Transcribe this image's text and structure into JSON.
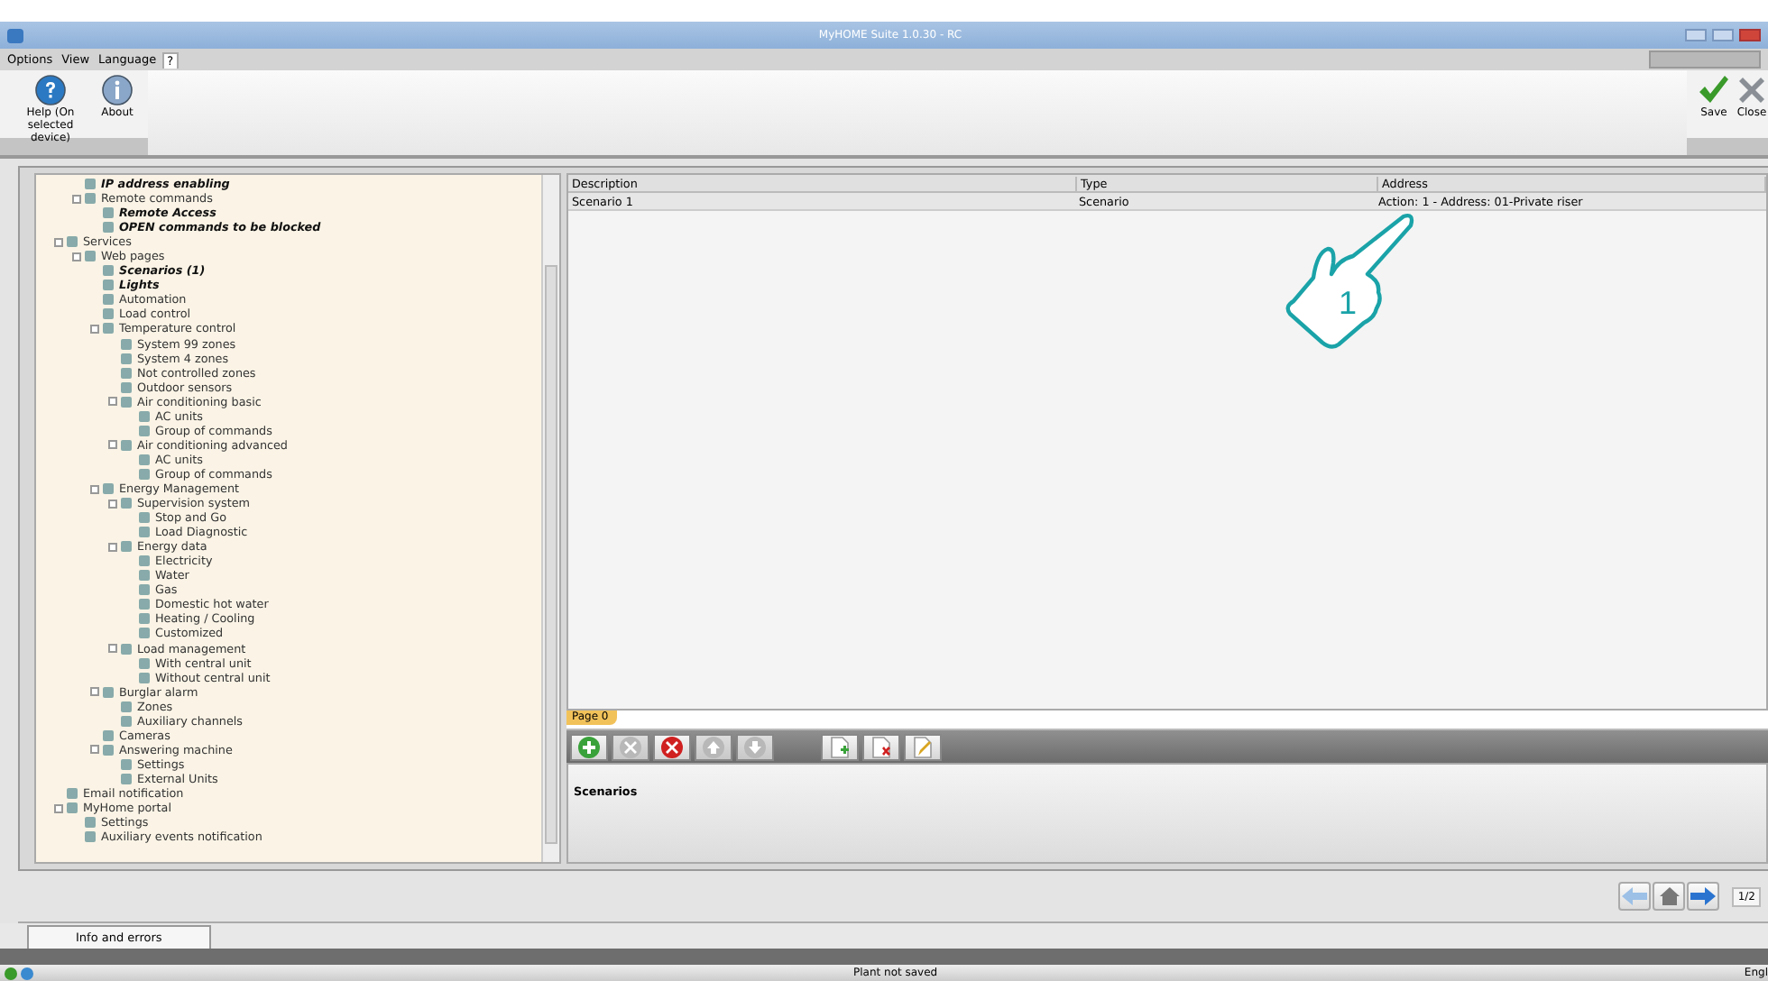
{
  "window": {
    "title": "MyHOME Suite 1.0.30 - RC"
  },
  "menu": [
    {
      "label": "Options",
      "selected": false
    },
    {
      "label": "View",
      "selected": false
    },
    {
      "label": "Language",
      "selected": false
    },
    {
      "label": "?",
      "selected": true
    }
  ],
  "ribbon": {
    "left": [
      {
        "label": "Help (On selected device)",
        "kind": "help"
      },
      {
        "label": "About",
        "kind": "about"
      }
    ],
    "right": [
      {
        "label": "Save",
        "kind": "save"
      },
      {
        "label": "Close",
        "kind": "close"
      }
    ]
  },
  "tree": [
    {
      "children": [
        {
          "label": "IP address enabling",
          "highlighted": true
        },
        {
          "label": "Remote commands",
          "highlighted": false,
          "children": [
            {
              "label": "Remote Access",
              "highlighted": true
            },
            {
              "label": "OPEN commands to be blocked",
              "highlighted": true
            }
          ]
        }
      ]
    },
    {
      "label": "Services",
      "highlighted": false,
      "children": [
        {
          "label": "Web pages",
          "highlighted": false,
          "children": [
            {
              "label": "Scenarios (1)",
              "highlighted": true
            },
            {
              "label": "Lights",
              "highlighted": true
            },
            {
              "label": "Automation",
              "highlighted": false
            },
            {
              "label": "Load control",
              "highlighted": false
            },
            {
              "label": "Temperature control",
              "highlighted": false,
              "children": [
                {
                  "label": "System 99 zones",
                  "highlighted": false
                },
                {
                  "label": "System 4 zones",
                  "highlighted": false
                },
                {
                  "label": "Not controlled zones",
                  "highlighted": false
                },
                {
                  "label": "Outdoor sensors",
                  "highlighted": false
                },
                {
                  "label": "Air conditioning basic",
                  "highlighted": false,
                  "children": [
                    {
                      "label": "AC units",
                      "highlighted": false
                    },
                    {
                      "label": "Group of commands",
                      "highlighted": false
                    }
                  ]
                },
                {
                  "label": "Air conditioning advanced",
                  "highlighted": false,
                  "children": [
                    {
                      "label": "AC units",
                      "highlighted": false
                    },
                    {
                      "label": "Group of commands",
                      "highlighted": false
                    }
                  ]
                }
              ]
            },
            {
              "label": "Energy Management",
              "highlighted": false,
              "children": [
                {
                  "label": "Supervision system",
                  "highlighted": false,
                  "children": [
                    {
                      "label": "Stop and Go",
                      "highlighted": false
                    },
                    {
                      "label": "Load Diagnostic",
                      "highlighted": false
                    }
                  ]
                },
                {
                  "label": "Energy data",
                  "highlighted": false,
                  "children": [
                    {
                      "label": "Electricity",
                      "highlighted": false
                    },
                    {
                      "label": "Water",
                      "highlighted": false
                    },
                    {
                      "label": "Gas",
                      "highlighted": false
                    },
                    {
                      "label": "Domestic hot water",
                      "highlighted": false
                    },
                    {
                      "label": "Heating / Cooling",
                      "highlighted": false
                    },
                    {
                      "label": "Customized",
                      "highlighted": false
                    }
                  ]
                },
                {
                  "label": "Load management",
                  "highlighted": false,
                  "children": [
                    {
                      "label": "With central unit",
                      "highlighted": false
                    },
                    {
                      "label": "Without central unit",
                      "highlighted": false
                    }
                  ]
                }
              ]
            },
            {
              "label": "Burglar alarm",
              "highlighted": false,
              "children": [
                {
                  "label": "Zones",
                  "highlighted": false
                },
                {
                  "label": "Auxiliary channels",
                  "highlighted": false
                }
              ]
            },
            {
              "label": "Cameras",
              "highlighted": false
            },
            {
              "label": "Answering machine",
              "highlighted": false,
              "children": [
                {
                  "label": "Settings",
                  "highlighted": false
                },
                {
                  "label": "External Units",
                  "highlighted": false
                }
              ]
            }
          ]
        }
      ]
    },
    {
      "label": "Email notification",
      "highlighted": false
    },
    {
      "label": "MyHome portal",
      "highlighted": false,
      "children": [
        {
          "label": "Settings",
          "highlighted": false
        },
        {
          "label": "Auxiliary events notification",
          "highlighted": false
        }
      ]
    }
  ],
  "table": {
    "columns": [
      "Description",
      "Type",
      "Address"
    ],
    "rows": [
      [
        "Scenario 1",
        "Scenario",
        "Action: 1 - Address: 01-Private riser"
      ]
    ]
  },
  "callout": {
    "number": "1"
  },
  "page_tab": {
    "label": "Page 0"
  },
  "toolbar": [
    {
      "kind": "add",
      "disabled": false
    },
    {
      "kind": "cancel",
      "disabled": true
    },
    {
      "kind": "delete",
      "disabled": false
    },
    {
      "kind": "up",
      "disabled": true
    },
    {
      "kind": "down",
      "disabled": true
    },
    {
      "kind": "page-add",
      "disabled": false
    },
    {
      "kind": "page-delete",
      "disabled": false
    },
    {
      "kind": "edit",
      "disabled": false
    }
  ],
  "panel": {
    "title": "Scenarios"
  },
  "nav": {
    "page": "1/2"
  },
  "bottom_tab": {
    "label": "Info and errors"
  },
  "status_bar": {
    "message": "Plant not saved",
    "language": "Engl"
  }
}
